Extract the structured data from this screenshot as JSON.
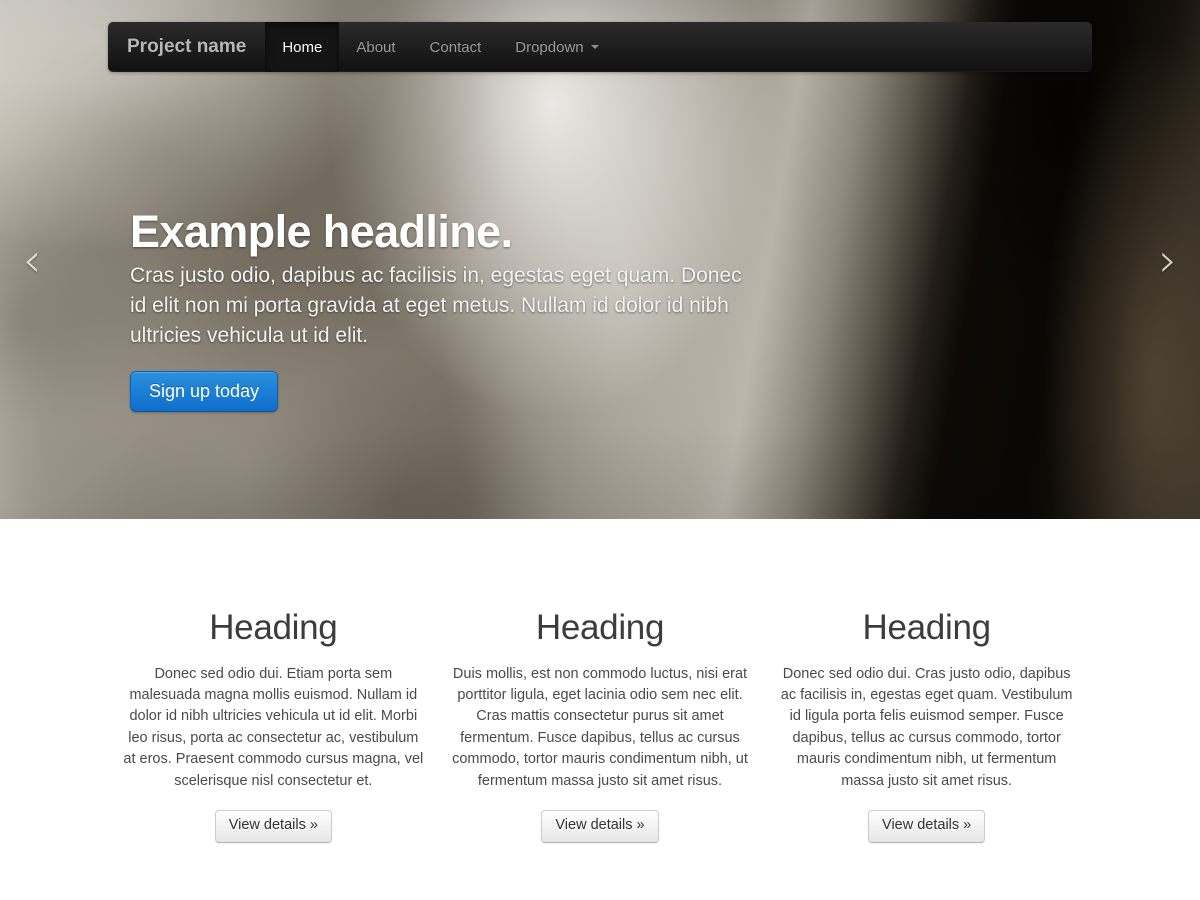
{
  "navbar": {
    "brand": "Project name",
    "items": [
      {
        "label": "Home",
        "active": true,
        "dropdown": false
      },
      {
        "label": "About",
        "active": false,
        "dropdown": false
      },
      {
        "label": "Contact",
        "active": false,
        "dropdown": false
      },
      {
        "label": "Dropdown",
        "active": false,
        "dropdown": true
      }
    ],
    "background_color": "#1d1d1d",
    "brand_color": "#b7b7b7",
    "link_color": "#9b9b9b",
    "active_link_color": "#ffffff"
  },
  "carousel": {
    "prev_icon": "chevron-left-icon",
    "next_icon": "chevron-right-icon",
    "prev_glyph": "‹",
    "next_glyph": "›",
    "caption": {
      "headline": "Example headline.",
      "lead": "Cras justo odio, dapibus ac facilisis in, egestas eget quam. Donec id elit non mi porta gravida at eget metus. Nullam id dolor id nibh ultricies vehicula ut id elit.",
      "cta_label": "Sign up today",
      "cta_color": "#1675cf"
    }
  },
  "marketing": {
    "columns": [
      {
        "heading": "Heading",
        "body": "Donec sed odio dui. Etiam porta sem malesuada magna mollis euismod. Nullam id dolor id nibh ultricies vehicula ut id elit. Morbi leo risus, porta ac consectetur ac, vestibulum at eros. Praesent commodo cursus magna, vel scelerisque nisl consectetur et.",
        "button_label": "View details »"
      },
      {
        "heading": "Heading",
        "body": "Duis mollis, est non commodo luctus, nisi erat porttitor ligula, eget lacinia odio sem nec elit. Cras mattis consectetur purus sit amet fermentum. Fusce dapibus, tellus ac cursus commodo, tortor mauris condimentum nibh, ut fermentum massa justo sit amet risus.",
        "button_label": "View details »"
      },
      {
        "heading": "Heading",
        "body": "Donec sed odio dui. Cras justo odio, dapibus ac facilisis in, egestas eget quam. Vestibulum id ligula porta felis euismod semper. Fusce dapibus, tellus ac cursus commodo, tortor mauris condimentum nibh, ut fermentum massa justo sit amet risus.",
        "button_label": "View details »"
      }
    ],
    "heading_color": "#3c3c3c",
    "body_color": "#4a4a4a",
    "background_color": "#ffffff"
  }
}
